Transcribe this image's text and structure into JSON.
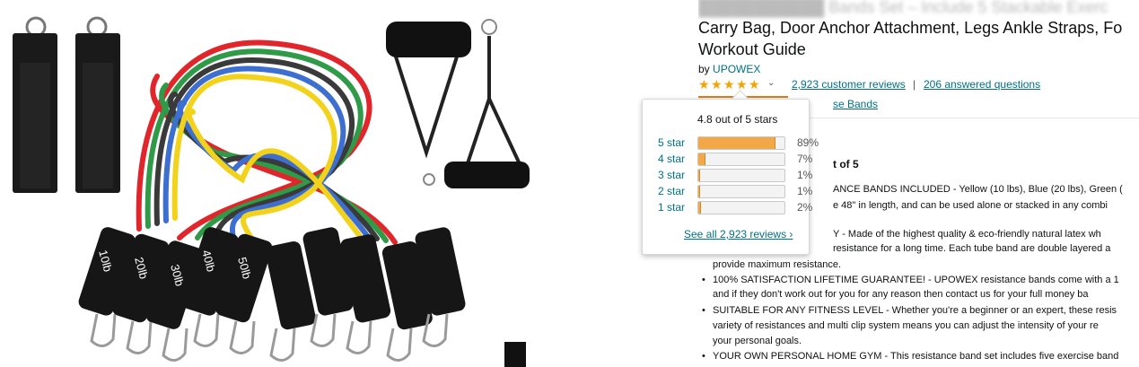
{
  "product": {
    "title_lines": [
      "███████████ Bands Set – Include 5 Stackable Exerc",
      "Carry Bag, Door Anchor Attachment, Legs Ankle Straps, Fo",
      "Workout Guide"
    ],
    "by_prefix": "by",
    "brand": "UPOWEX",
    "reviews_link": "2,923 customer reviews",
    "separator": "|",
    "questions_link": "206 answered questions",
    "behind_link": "se Bands",
    "behind_heading": "t of 5"
  },
  "rating": {
    "average": 4.8,
    "max": 5,
    "stars": [
      "★",
      "★",
      "★",
      "★",
      "★"
    ],
    "dropdown_icon": "chevron-down"
  },
  "popover": {
    "summary": "4.8 out of 5 stars",
    "rows": [
      {
        "label": "5 star",
        "pct": "89%",
        "fraction": 0.89
      },
      {
        "label": "4 star",
        "pct": "7%",
        "fraction": 0.07
      },
      {
        "label": "3 star",
        "pct": "1%",
        "fraction": 0.01
      },
      {
        "label": "2 star",
        "pct": "1%",
        "fraction": 0.01
      },
      {
        "label": "1 star",
        "pct": "2%",
        "fraction": 0.02
      }
    ],
    "see_all": "See all 2,923 reviews ›"
  },
  "bullets": [
    {
      "text": "ANCE BANDS INCLUDED - Yellow (10 lbs), Blue (20 lbs), Green (",
      "indent": 150,
      "bullet": false
    },
    {
      "text": "e 48\" in length, and can be used alone or stacked in any combi",
      "indent": 150,
      "bullet": false
    },
    {
      "text": "Y - Made of the highest quality & eco-friendly natural latex wh",
      "indent": 150,
      "bullet": false
    },
    {
      "text": "resistance for a long time. Each tube band are double layered a",
      "indent": 150,
      "bullet": false
    },
    {
      "text": "provide maximum resistance.",
      "indent": 16,
      "bullet": false
    },
    {
      "text": "100% SATISFACTION LIFETIME GUARANTEE! - UPOWEX resistance bands come with a 1",
      "indent": 0,
      "bullet": true
    },
    {
      "text": "and if they don't work out for you for any reason then contact us for your full money ba",
      "indent": 16,
      "bullet": false
    },
    {
      "text": "SUITABLE FOR ANY FITNESS LEVEL - Whether you're a beginner or an expert, these resis",
      "indent": 0,
      "bullet": true
    },
    {
      "text": "variety of resistances and multi clip system means you can adjust the intensity of your re",
      "indent": 16,
      "bullet": false
    },
    {
      "text": "your personal goals.",
      "indent": 16,
      "bullet": false
    },
    {
      "text": "YOUR OWN PERSONAL HOME GYM - This resistance band set includes five exercise band",
      "indent": 0,
      "bullet": true
    }
  ],
  "image": {
    "band_colors": [
      "#e0252b",
      "#2f9a48",
      "#3a3a3a",
      "#3d6fd0",
      "#f2d21b"
    ],
    "handle_labels": [
      "10lb",
      "20lb",
      "30lb",
      "40lb",
      "50lb"
    ]
  }
}
